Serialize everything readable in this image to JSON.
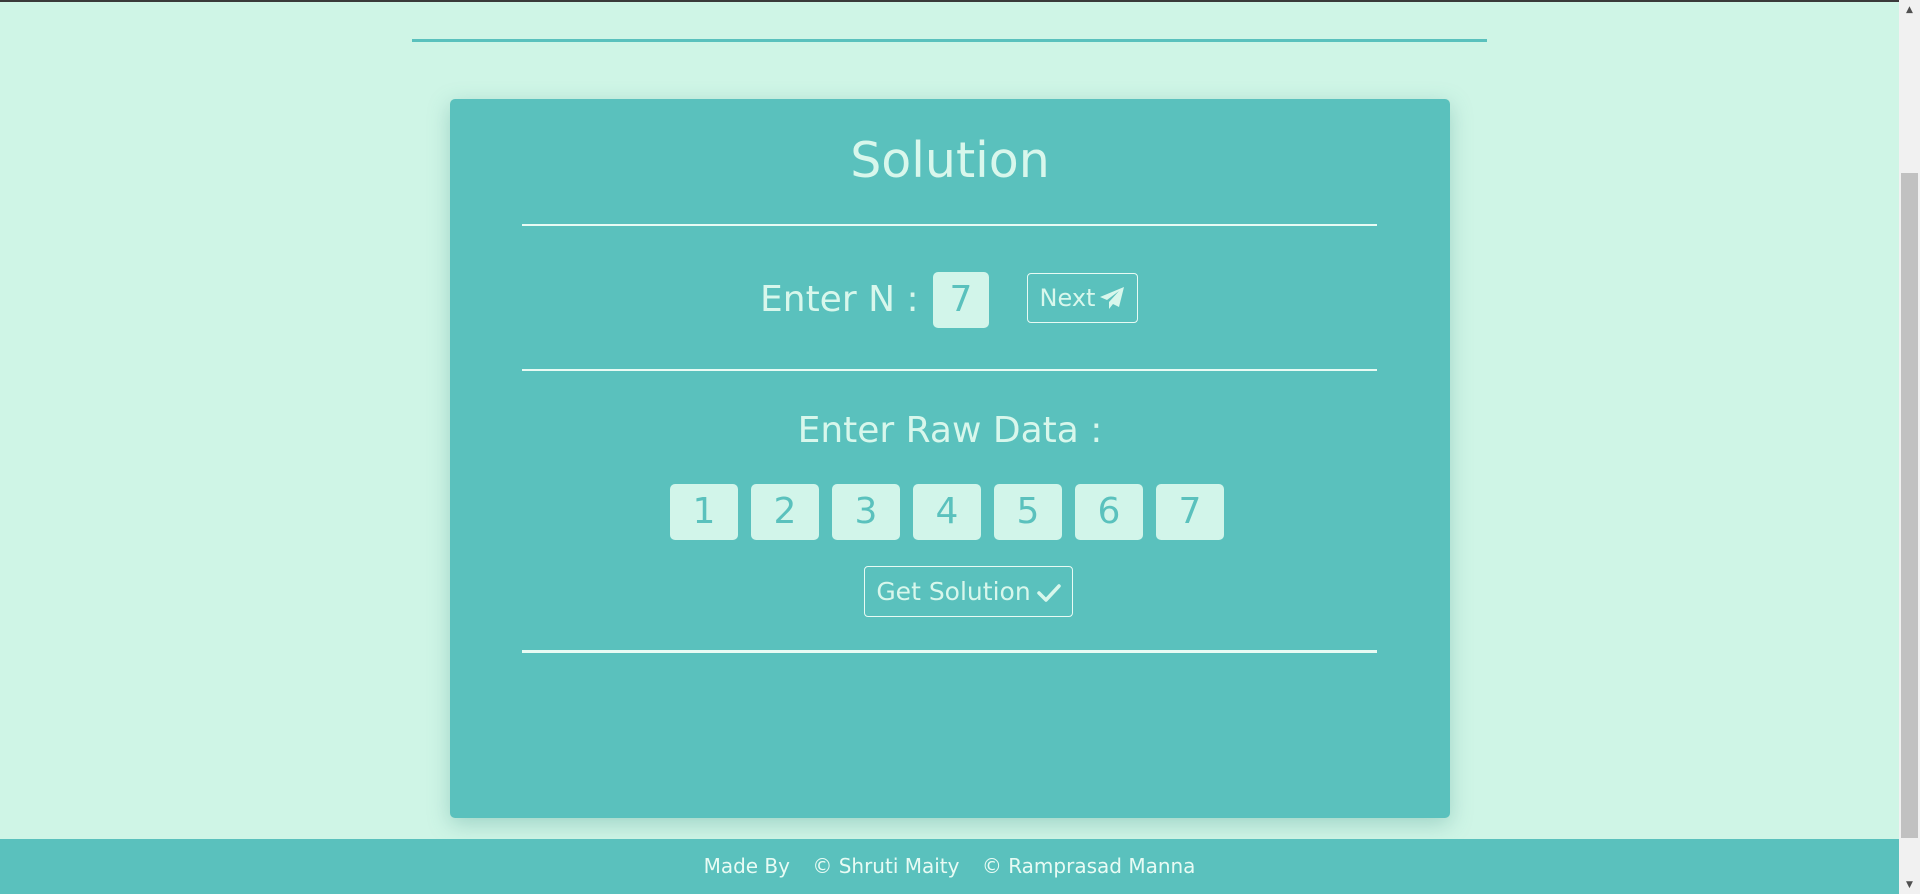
{
  "card": {
    "title": "Solution",
    "n_label": "Enter N :",
    "n_value": "7",
    "next_label": "Next",
    "raw_label": "Enter Raw Data :",
    "raw_values": [
      "1",
      "2",
      "3",
      "4",
      "5",
      "6",
      "7"
    ],
    "solve_label": "Get Solution"
  },
  "footer": {
    "made_by": "Made By",
    "author1": "© Shruti Maity",
    "author2": "© Ramprasad Manna"
  },
  "icons": {
    "next": "paper-plane-icon",
    "solve": "check-icon"
  },
  "colors": {
    "background": "#cff5e6",
    "accent": "#5ac1bd",
    "text_light": "#d8f7ec"
  }
}
